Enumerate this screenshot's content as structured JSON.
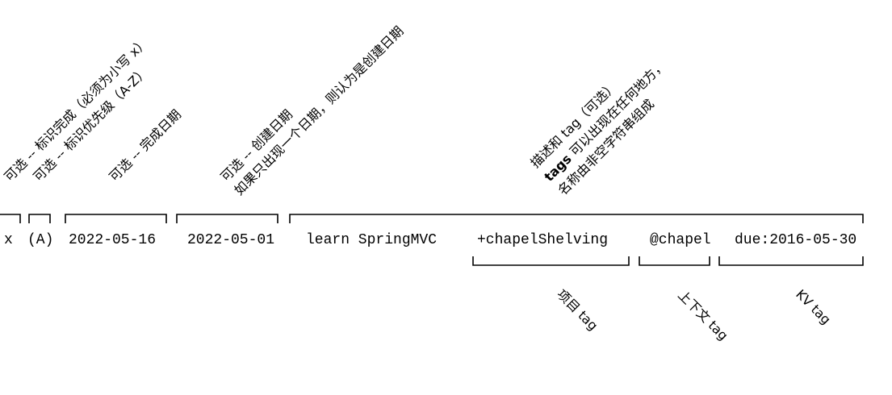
{
  "todo_line": {
    "done_mark": "x",
    "priority": "(A)",
    "completion_date": "2022-05-16",
    "creation_date": "2022-05-01",
    "description_text": "learn SpringMVC",
    "project_tag": "+chapelShelving",
    "context_tag": "@chapel",
    "kv_tag": "due:2016-05-30"
  },
  "annotations_top": {
    "done": "可选 -- 标识完成（必须为小写 x）",
    "priority": "可选 -- 标识优先级（A-Z）",
    "completion_date": "可选 -- 完成日期",
    "creation_date_line1": "可选 -- 创建日期",
    "creation_date_line2": "如果只出现一个日期，则认为是创建日期",
    "description_line1": "描述和 tag（可选）",
    "description_line2_bold": "tags",
    "description_line2_rest": " 可以出现在任何地方，",
    "description_line3": "名称由非空字符串组成"
  },
  "annotations_bottom": {
    "project_tag": "项目 tag",
    "context_tag": "上下文 tag",
    "kv_tag": "KV tag"
  }
}
